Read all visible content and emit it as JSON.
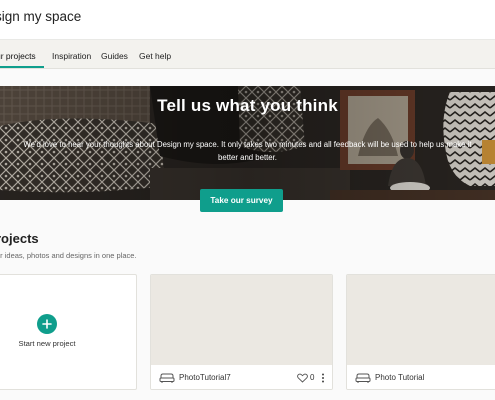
{
  "header": {
    "title": "sign my space"
  },
  "tabs": [
    {
      "label": "ur projects",
      "active": true
    },
    {
      "label": "Inspiration",
      "active": false
    },
    {
      "label": "Guides",
      "active": false
    },
    {
      "label": "Get help",
      "active": false
    }
  ],
  "hero": {
    "title": "Tell us what you think",
    "text": "We'd love to hear your thoughts about Design my space. It only takes two minutes and all feedback will be used to help us make it better and better.",
    "button_label": "Take our survey"
  },
  "projects": {
    "title": "rojects",
    "subtitle": "ur ideas, photos and designs in one place.",
    "new_project_label": "Start new project",
    "cards": [
      {
        "name": "PhotoTutorial7",
        "likes": "0"
      },
      {
        "name": "Photo Tutorial",
        "likes": ""
      }
    ]
  },
  "colors": {
    "accent": "#0f9e8c",
    "tab_background": "#f3f2ee",
    "thumbnail": "#ebe8e2"
  },
  "icons": {
    "add": "plus-icon",
    "room": "sofa-icon",
    "like": "heart-icon",
    "more": "more-vertical-icon"
  }
}
